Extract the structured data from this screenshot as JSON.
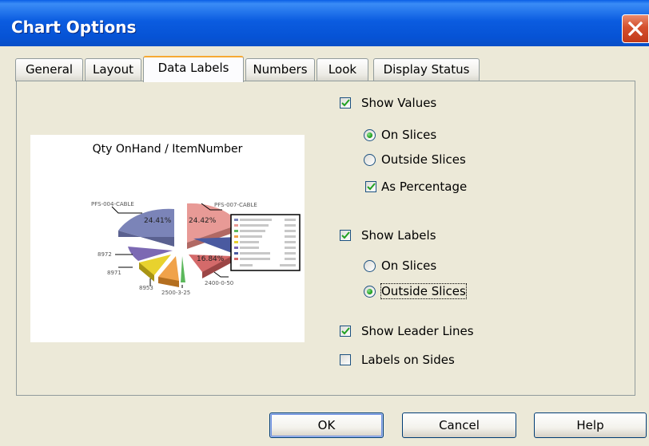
{
  "window": {
    "title": "Chart Options"
  },
  "tabs": [
    {
      "label": "General"
    },
    {
      "label": "Layout"
    },
    {
      "label": "Data Labels"
    },
    {
      "label": "Numbers"
    },
    {
      "label": "Look"
    },
    {
      "label": "Display Status"
    }
  ],
  "active_tab": "Data Labels",
  "preview": {
    "title": "Qty OnHand / ItemNumber",
    "slice_labels": [
      "PFS-004-CABLE",
      "PFS-007-CABLE",
      "8972",
      "8971",
      "8953",
      "2500-3-25",
      "2400-0-50"
    ],
    "value_labels": [
      "24.41%",
      "24.42%",
      "16.84%"
    ]
  },
  "options": {
    "show_values": {
      "label": "Show Values",
      "checked": true
    },
    "on_slices_values": {
      "label": "On Slices",
      "selected": true
    },
    "outside_slices_values": {
      "label": "Outside Slices",
      "selected": false
    },
    "as_percentage": {
      "label": "As Percentage",
      "checked": true
    },
    "show_labels": {
      "label": "Show Labels",
      "checked": true
    },
    "on_slices_labels": {
      "label": "On Slices",
      "selected": false
    },
    "outside_slices_labels": {
      "label": "Outside Slices",
      "selected": true
    },
    "show_leader_lines": {
      "label": "Show Leader Lines",
      "checked": true
    },
    "labels_on_sides": {
      "label": "Labels on Sides",
      "checked": false
    }
  },
  "buttons": {
    "ok": "OK",
    "cancel": "Cancel",
    "help": "Help"
  }
}
